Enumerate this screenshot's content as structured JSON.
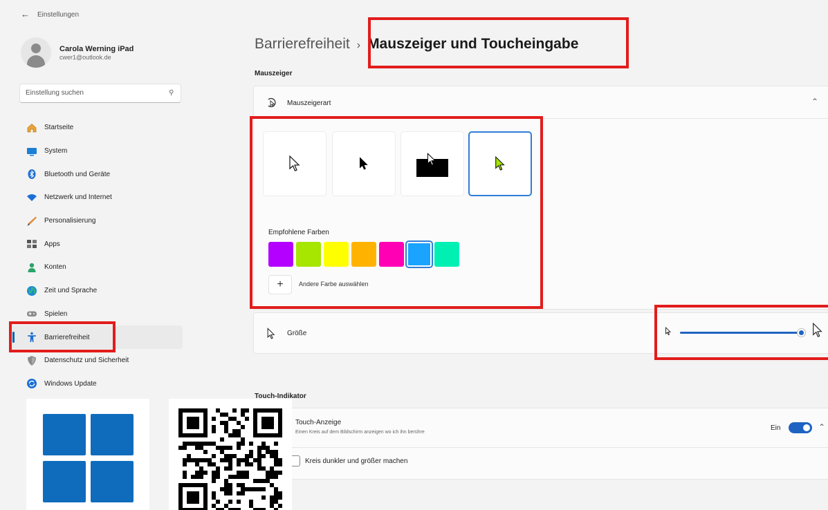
{
  "window": {
    "back_icon": "back-arrow-icon",
    "title": "Einstellungen"
  },
  "profile": {
    "name": "Carola Werning iPad",
    "email": "cwer1@outlook.de"
  },
  "search": {
    "placeholder": "Einstellung suchen",
    "icon": "search-icon"
  },
  "sidebar": {
    "items": [
      {
        "label": "Startseite",
        "icon": "home-icon"
      },
      {
        "label": "System",
        "icon": "monitor-icon"
      },
      {
        "label": "Bluetooth und Geräte",
        "icon": "bluetooth-icon"
      },
      {
        "label": "Netzwerk und Internet",
        "icon": "wifi-icon"
      },
      {
        "label": "Personalisierung",
        "icon": "brush-icon"
      },
      {
        "label": "Apps",
        "icon": "apps-icon"
      },
      {
        "label": "Konten",
        "icon": "person-icon"
      },
      {
        "label": "Zeit und Sprache",
        "icon": "globe-icon"
      },
      {
        "label": "Spielen",
        "icon": "gamepad-icon"
      },
      {
        "label": "Barrierefreiheit",
        "icon": "accessibility-icon",
        "active": true
      },
      {
        "label": "Datenschutz und Sicherheit",
        "icon": "shield-icon"
      },
      {
        "label": "Windows Update",
        "icon": "update-icon"
      }
    ]
  },
  "header": {
    "parent": "Barrierefreiheit",
    "separator": "›",
    "current": "Mauszeiger und Toucheingabe"
  },
  "mouse": {
    "section_title": "Mauszeiger",
    "style_label": "Mauszeigerart",
    "styles": [
      {
        "name": "weiß",
        "selected": false
      },
      {
        "name": "schwarz",
        "selected": false
      },
      {
        "name": "umgekehrt",
        "selected": false
      },
      {
        "name": "benutzerdefiniert",
        "selected": true
      }
    ],
    "recommended_colors_label": "Empfohlene Farben",
    "colors": [
      "#b400ff",
      "#a6e600",
      "#ffff00",
      "#ffb300",
      "#ff00b4",
      "#1aa3ff",
      "#00f0b4"
    ],
    "selected_color_index": 5,
    "custom_pointer_color": "#a6e600",
    "add_color_label": "Andere Farbe auswählen",
    "size_label": "Größe",
    "size_level": 1.0
  },
  "touch": {
    "section_title": "Touch-Indikator",
    "title": "Touch-Anzeige",
    "description": "Einen Kreis auf dem Bildschirm anzeigen wo ich ihn berühre",
    "toggle_label": "Ein",
    "toggle_on": true,
    "checkbox_label": "Kreis dunkler und größer machen",
    "checkbox_checked": false
  },
  "colors": {
    "accent": "#005fb8",
    "highlight": "#e21c1c",
    "windows_logo": "#0f6cbd"
  }
}
